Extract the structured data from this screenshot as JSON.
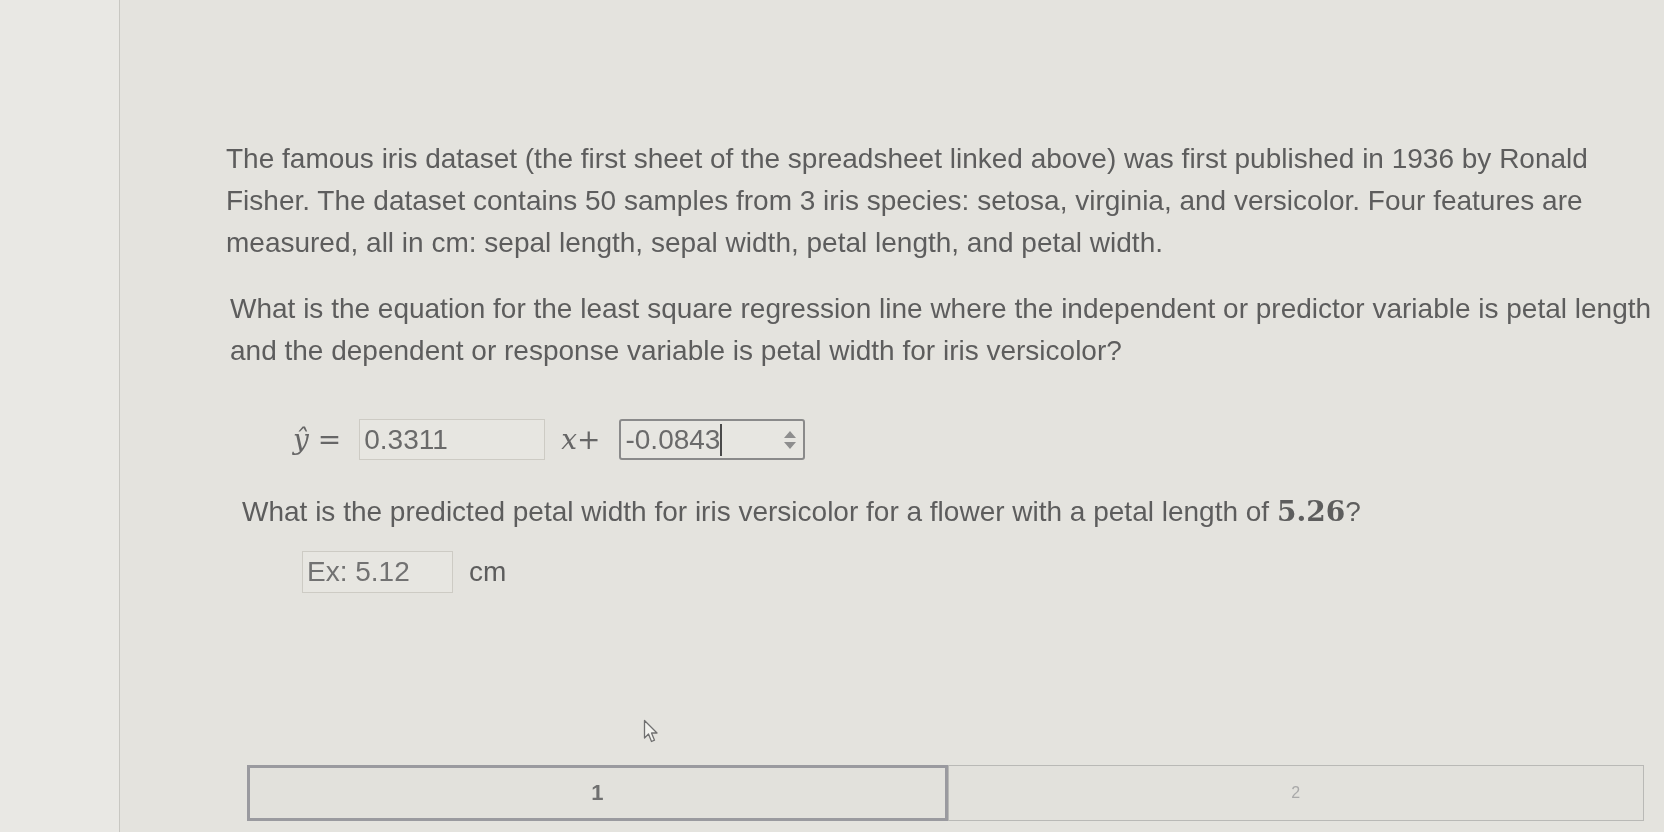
{
  "passage": "The famous iris dataset (the first sheet of the spreadsheet linked above) was first published in 1936 by Ronald Fisher. The dataset contains 50 samples from 3 iris species: setosa, virginia, and versicolor. Four features are measured, all in cm: sepal length, sepal width, petal length, and petal width.",
  "question_1": {
    "text": "What is the equation for the least square regression line where the independent or predictor variable is petal length and the dependent or response variable is petal width for iris versicolor?",
    "equation": {
      "lhs": "*ŷ* =",
      "slope": {
        "kind": "text",
        "value": "0.3311",
        "focused": false
      },
      "term": "*x*+",
      "intercept": {
        "kind": "number",
        "value": "-0.0843",
        "focused": true
      }
    }
  },
  "question_2": {
    "text": "What is the predicted petal width for iris versicolor for a flower with a petal length of **5.26**?",
    "answer": {
      "placeholder": "Ex: 5.12",
      "unit": "cm"
    }
  },
  "pages": [
    {
      "label": "1",
      "selected": true
    },
    {
      "label": "2",
      "selected": false
    }
  ]
}
